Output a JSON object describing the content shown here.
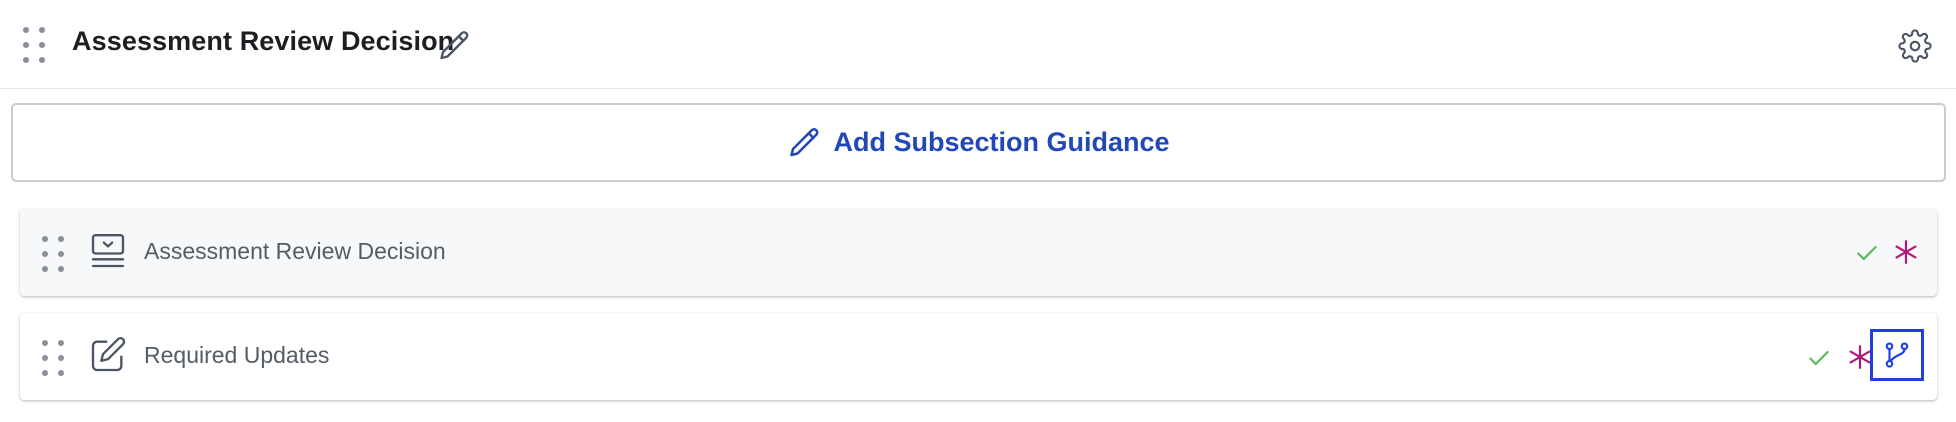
{
  "section": {
    "title": "Assessment Review Decision",
    "icons": {
      "drag": "drag-handle-icon",
      "edit_title": "pencil-icon",
      "settings": "gear-icon"
    }
  },
  "guidance": {
    "label": "Add Subsection Guidance",
    "icon": "pencil-icon"
  },
  "questions": [
    {
      "label": "Assessment Review Decision",
      "type_icon": "dropdown-select-icon",
      "valid": true,
      "required": true
    },
    {
      "label": "Required Updates",
      "type_icon": "edit-text-icon",
      "valid": true,
      "required": true,
      "branching": true
    }
  ],
  "colors": {
    "accent_blue": "#2247b8",
    "check_green": "#5cb85c",
    "required_magenta": "#b0177a",
    "branch_blue": "#1f3fe0"
  }
}
